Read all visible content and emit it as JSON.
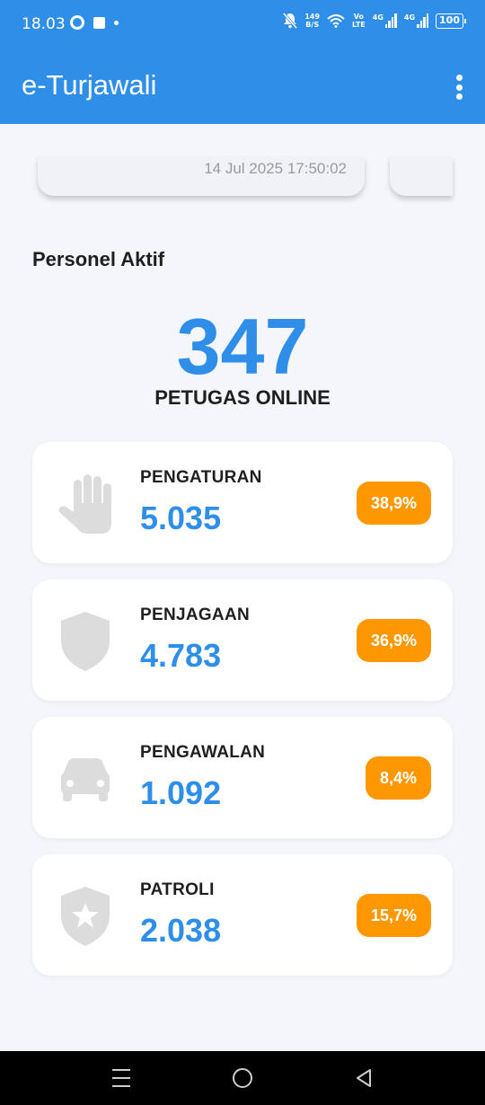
{
  "status_bar": {
    "time": "18.03",
    "net_speed_value": "149",
    "net_speed_unit": "B/S",
    "volte_top": "Vo",
    "volte_bottom": "LTE",
    "net1": "4G",
    "net2": "4G",
    "battery": "100"
  },
  "app_bar": {
    "title": "e-Turjawali",
    "menu_icon": "more-vert-icon"
  },
  "carousel": {
    "timestamp": "14 Jul 2025 17:50:02"
  },
  "section": {
    "title": "Personel Aktif"
  },
  "online": {
    "count": "347",
    "label": "PETUGAS ONLINE"
  },
  "stats": [
    {
      "label": "PENGATURAN",
      "value": "5.035",
      "percent": "38,9%",
      "icon": "hand-icon",
      "fraction": 0.389
    },
    {
      "label": "PENJAGAAN",
      "value": "4.783",
      "percent": "36,9%",
      "icon": "shield-icon",
      "fraction": 0.369
    },
    {
      "label": "PENGAWALAN",
      "value": "1.092",
      "percent": "8,4%",
      "icon": "car-icon",
      "fraction": 0.084
    },
    {
      "label": "PATROLI",
      "value": "2.038",
      "percent": "15,7%",
      "icon": "star-shield-icon",
      "fraction": 0.157
    }
  ],
  "colors": {
    "primary": "#2f8fe8",
    "badge": "#ff9800",
    "icon_gray": "#dcdcdc",
    "background": "#f4f6fb"
  }
}
